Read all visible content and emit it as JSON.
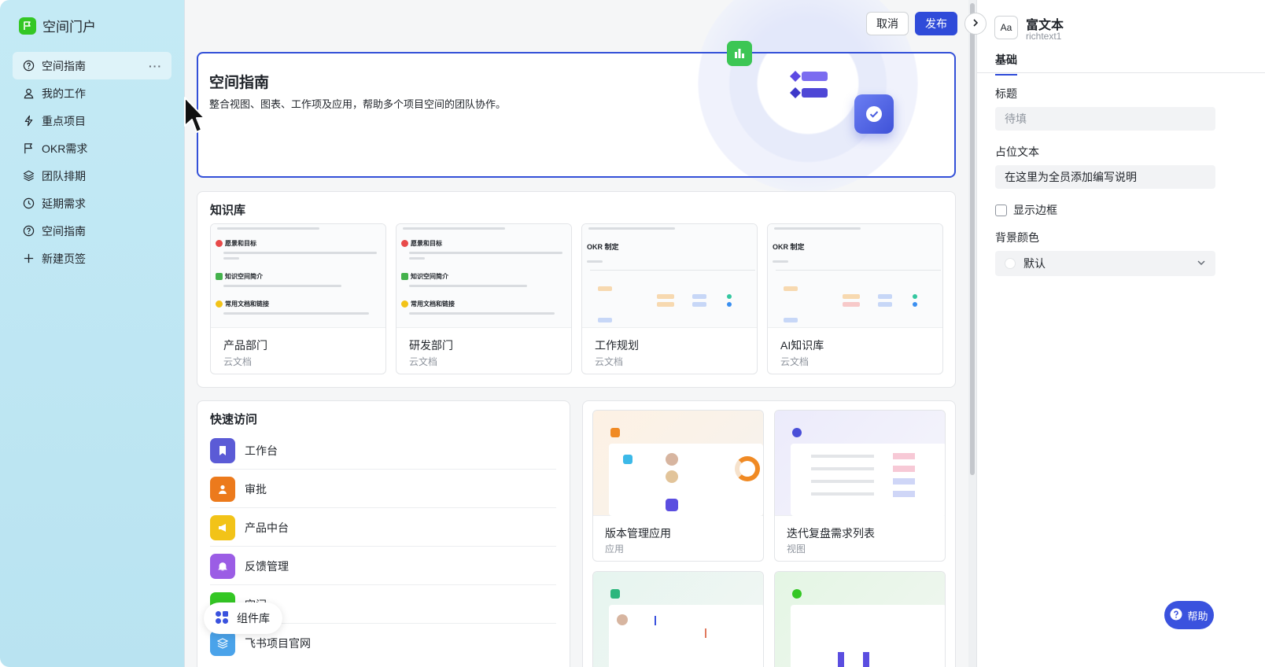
{
  "sidebar": {
    "brand": "空间门户",
    "items": [
      {
        "label": "空间指南",
        "icon": "help-circle-icon",
        "active": true
      },
      {
        "label": "我的工作",
        "icon": "user-icon"
      },
      {
        "label": "重点项目",
        "icon": "lightning-icon"
      },
      {
        "label": "OKR需求",
        "icon": "flag-icon"
      },
      {
        "label": "团队排期",
        "icon": "layers-icon"
      },
      {
        "label": "延期需求",
        "icon": "clock-icon"
      },
      {
        "label": "空间指南",
        "icon": "help-circle-icon"
      },
      {
        "label": "新建页签",
        "icon": "plus-icon"
      }
    ],
    "more": "···"
  },
  "toolbar": {
    "cancel": "取消",
    "publish": "发布"
  },
  "hero": {
    "title": "空间指南",
    "desc": "整合视图、图表、工作项及应用，帮助多个项目空间的团队协作。"
  },
  "knowledge": {
    "title": "知识库",
    "cards": [
      {
        "name": "产品部门",
        "type": "云文档"
      },
      {
        "name": "研发部门",
        "type": "云文档"
      },
      {
        "name": "工作规划",
        "type": "云文档"
      },
      {
        "name": "AI知识库",
        "type": "云文档"
      }
    ],
    "preview_heads": [
      "愿景和目标",
      "知识空间简介",
      "常用文档和链接"
    ],
    "okr_head": "OKR 制定"
  },
  "quick": {
    "title": "快速访问",
    "items": [
      {
        "label": "工作台",
        "color": "#5b5bd6",
        "icon": "bookmark-icon"
      },
      {
        "label": "审批",
        "color": "#ec7a1c",
        "icon": "person-icon"
      },
      {
        "label": "产品中台",
        "color": "#f2c318",
        "icon": "megaphone-icon"
      },
      {
        "label": "反馈管理",
        "color": "#9b5de5",
        "icon": "bell-icon"
      },
      {
        "label": "空间",
        "color": "#34c724",
        "icon": "space-icon"
      },
      {
        "label": "飞书项目官网",
        "color": "#4aa3ea",
        "icon": "stack-icon"
      }
    ]
  },
  "apps": [
    {
      "name": "版本管理应用",
      "type": "应用"
    },
    {
      "name": "迭代复盘需求列表",
      "type": "视图"
    }
  ],
  "widget_lib": "组件库",
  "panel": {
    "title": "富文本",
    "sub": "richtext1",
    "icon_text": "Aa",
    "tab": "基础",
    "title_label": "标题",
    "title_placeholder": "待填",
    "placeholder_label": "占位文本",
    "placeholder_value": "在这里为全员添加编写说明",
    "border_label": "显示边框",
    "bg_label": "背景颜色",
    "bg_value": "默认"
  },
  "help": "帮助",
  "colors": {
    "accent": "#2f4bd9",
    "sidebar_bg": "#c4eaf5",
    "brand_green": "#34c724"
  }
}
